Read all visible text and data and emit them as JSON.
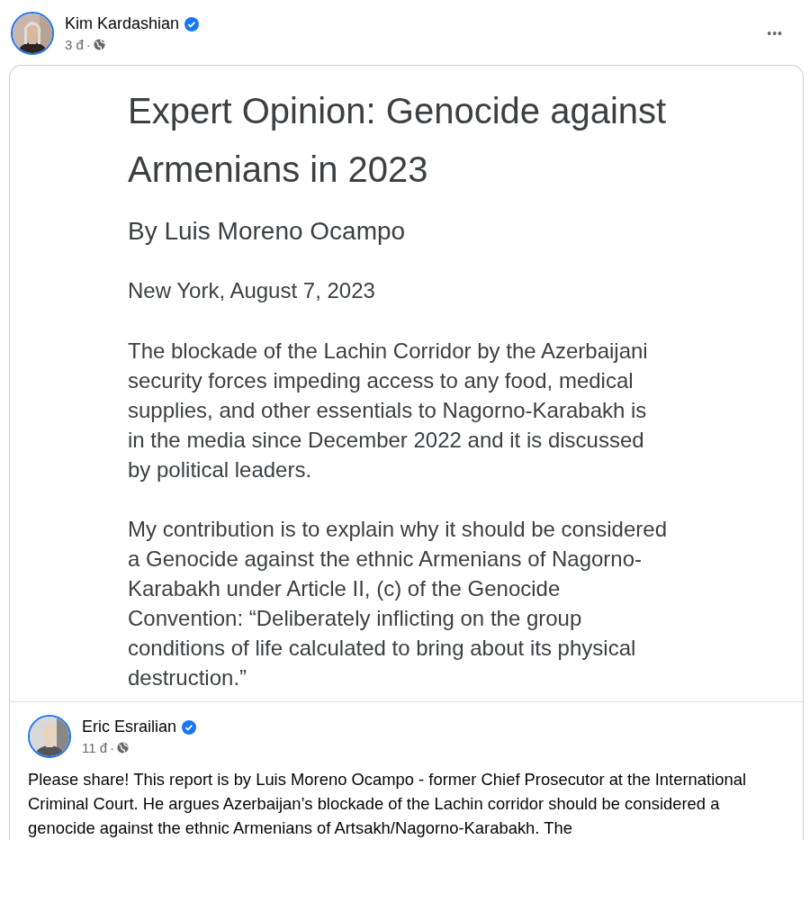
{
  "post": {
    "author": "Kim Kardashian",
    "verified": true,
    "time": "3 đ",
    "separator": "·",
    "more": "•••"
  },
  "document": {
    "title": "Expert Opinion: Genocide against Armenians in 2023",
    "byline": "By Luis Moreno Ocampo",
    "dateline": "New York, August 7, 2023",
    "paragraphs": [
      "The blockade of the Lachin Corridor by the Azerbaijani security forces impeding access to any food, medical supplies, and other essentials to Nagorno-Karabakh is in the media since December 2022 and it is discussed by political leaders.",
      "My contribution is to explain why it should be considered a Genocide against the ethnic Armenians of Nagorno-Karabakh under Article II, (c) of the Genocide Convention: “Deliberately inflicting on the group conditions of life calculated to bring about its physical destruction.”"
    ]
  },
  "shared_post": {
    "author": "Eric Esrailian",
    "verified": true,
    "time": "11 đ",
    "separator": "·",
    "text": "Please share! This report is by Luis Moreno Ocampo - former Chief Prosecutor at the International Criminal Court. He argues Azerbaijan’s blockade of the Lachin corridor should be considered a genocide against the ethnic Armenians of Artsakh/Nagorno-Karabakh. The"
  }
}
